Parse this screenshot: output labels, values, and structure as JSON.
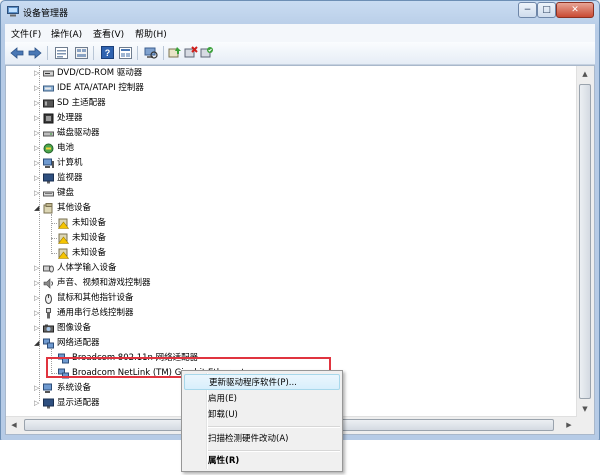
{
  "window": {
    "title": "设备管理器",
    "controls": {
      "minimize": "−",
      "maximize": "□",
      "close": "✕"
    }
  },
  "menubar": [
    "文件(F)",
    "操作(A)",
    "查看(V)",
    "帮助(H)"
  ],
  "toolbar": {
    "icons": [
      "back-arrow-icon",
      "forward-arrow-icon",
      "computer-view-icon",
      "device-list-icon",
      "help-icon",
      "properties-icon",
      "scan-hardware-icon",
      "update-driver-icon",
      "uninstall-icon",
      "enable-device-icon"
    ]
  },
  "tree": {
    "items": [
      {
        "label": "DVD/CD-ROM 驱动器",
        "icon": "dvd-drive-icon",
        "expander": "▷"
      },
      {
        "label": "IDE ATA/ATAPI 控制器",
        "icon": "ide-controller-icon",
        "expander": "▷"
      },
      {
        "label": "SD 主适配器",
        "icon": "sd-adapter-icon",
        "expander": "▷"
      },
      {
        "label": "处理器",
        "icon": "processor-icon",
        "expander": "▷"
      },
      {
        "label": "磁盘驱动器",
        "icon": "disk-drive-icon",
        "expander": "▷"
      },
      {
        "label": "电池",
        "icon": "battery-icon",
        "expander": "▷"
      },
      {
        "label": "计算机",
        "icon": "computer-icon",
        "expander": "▷"
      },
      {
        "label": "监视器",
        "icon": "monitor-icon",
        "expander": "▷"
      },
      {
        "label": "键盘",
        "icon": "keyboard-icon",
        "expander": "▷"
      },
      {
        "label": "其他设备",
        "icon": "other-devices-icon",
        "expander": "◢"
      },
      {
        "label": "未知设备",
        "icon": "unknown-device-warning-icon",
        "expander": ""
      },
      {
        "label": "未知设备",
        "icon": "unknown-device-warning-icon",
        "expander": ""
      },
      {
        "label": "未知设备",
        "icon": "unknown-device-warning-icon",
        "expander": ""
      },
      {
        "label": "人体学输入设备",
        "icon": "hid-icon",
        "expander": "▷"
      },
      {
        "label": "声音、视频和游戏控制器",
        "icon": "sound-icon",
        "expander": "▷"
      },
      {
        "label": "鼠标和其他指针设备",
        "icon": "mouse-icon",
        "expander": "▷"
      },
      {
        "label": "通用串行总线控制器",
        "icon": "usb-icon",
        "expander": "▷"
      },
      {
        "label": "图像设备",
        "icon": "imaging-device-icon",
        "expander": "▷"
      },
      {
        "label": "网络适配器",
        "icon": "network-adapter-icon",
        "expander": "◢"
      },
      {
        "label": "Broadcom 802.11n 网络适配器",
        "icon": "network-card-icon",
        "expander": ""
      },
      {
        "label": "Broadcom NetLink (TM) Gigabit Ethernet",
        "icon": "network-card-icon",
        "expander": ""
      },
      {
        "label": "系统设备",
        "icon": "system-device-icon",
        "expander": "▷"
      },
      {
        "label": "显示适配器",
        "icon": "display-adapter-icon",
        "expander": "▷"
      }
    ]
  },
  "context_menu": {
    "items": [
      "更新驱动程序软件(P)...",
      "启用(E)",
      "卸载(U)",
      "扫描检测硬件改动(A)",
      "属性(R)"
    ]
  },
  "colors": {
    "highlight": "#e0343f",
    "accent": "#3a6ea5"
  }
}
